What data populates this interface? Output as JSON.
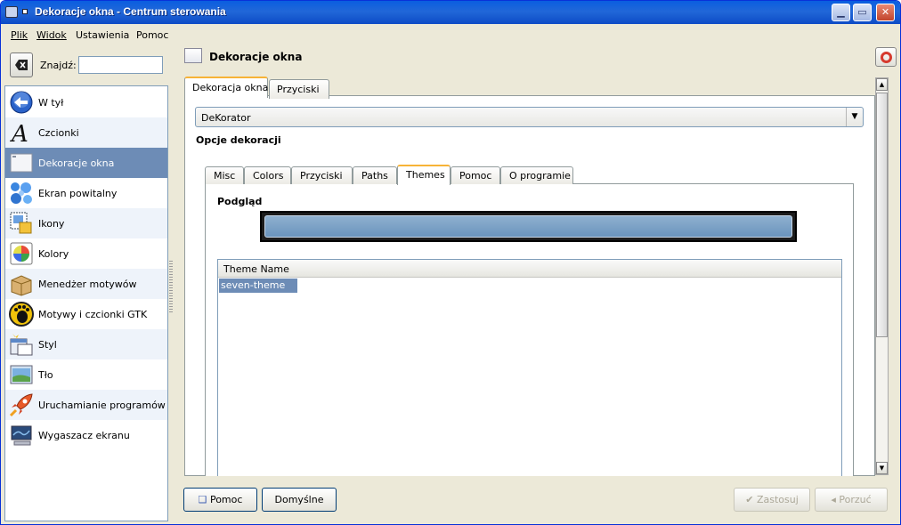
{
  "window": {
    "title": "Dekoracje okna - Centrum sterowania"
  },
  "menu": [
    "Plik",
    "Widok",
    "Ustawienia",
    "Pomoc"
  ],
  "search": {
    "label": "Znajdź:",
    "value": ""
  },
  "sidebar": {
    "items": [
      {
        "label": "W tył",
        "icon": "back-arrow-icon"
      },
      {
        "label": "Czcionki",
        "icon": "font-icon"
      },
      {
        "label": "Dekoracje okna",
        "icon": "window-decoration-icon",
        "selected": true
      },
      {
        "label": "Ekran powitalny",
        "icon": "splash-bubbles-icon"
      },
      {
        "label": "Ikony",
        "icon": "icons-icon"
      },
      {
        "label": "Kolory",
        "icon": "colors-icon"
      },
      {
        "label": "Menedżer motywów",
        "icon": "theme-manager-box-icon"
      },
      {
        "label": "Motywy i czcionki GTK",
        "icon": "gnome-foot-icon"
      },
      {
        "label": "Styl",
        "icon": "style-icon"
      },
      {
        "label": "Tło",
        "icon": "background-icon"
      },
      {
        "label": "Uruchamianie programów",
        "icon": "rocket-icon"
      },
      {
        "label": "Wygaszacz ekranu",
        "icon": "screensaver-icon"
      }
    ]
  },
  "header": {
    "title": "Dekoracje okna"
  },
  "top_tabs": [
    "Dekoracja okna",
    "Przyciski"
  ],
  "decorator": {
    "value": "DeKorator"
  },
  "options_label": "Opcje dekoracji",
  "inner_tabs": [
    "Misc",
    "Colors",
    "Przyciski",
    "Paths",
    "Themes",
    "Pomoc",
    "O programie"
  ],
  "preview_label": "Podgląd",
  "theme_list": {
    "column": "Theme Name",
    "rows": [
      "seven-theme"
    ]
  },
  "buttons": {
    "help": "Pomoc",
    "defaults": "Domyślne",
    "apply": "Zastosuj",
    "discard": "Porzuć"
  },
  "colors": {
    "selection": "#6d8cb6",
    "titlebar": "#0a5ee0",
    "tab_highlight": "#f7b337"
  }
}
